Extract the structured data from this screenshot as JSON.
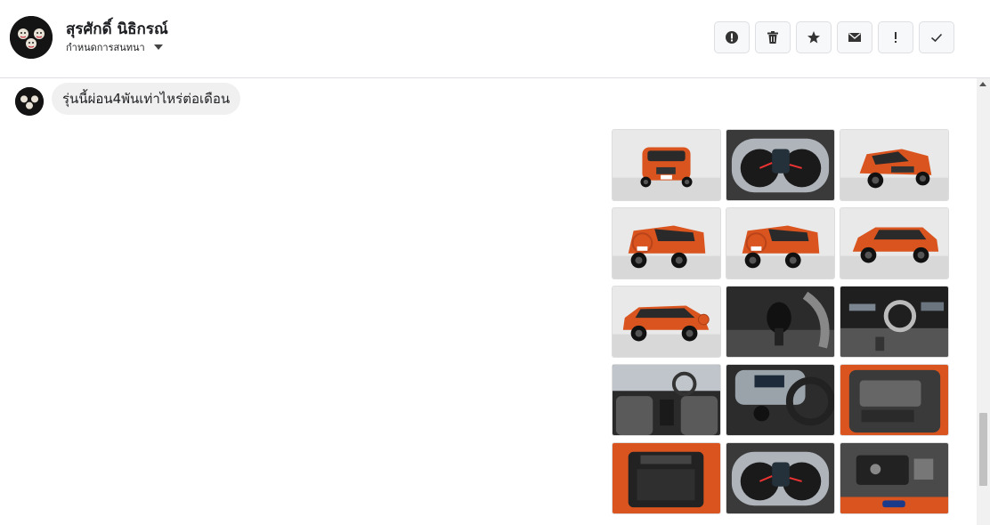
{
  "header": {
    "contact_name": "สุรศักดิ์ นิธิกรณ์",
    "subtitle": "กำหนดการสนทนา",
    "actions": [
      {
        "name": "spam-button",
        "icon": "alert-circle-icon"
      },
      {
        "name": "delete-button",
        "icon": "trash-icon"
      },
      {
        "name": "star-button",
        "icon": "star-icon"
      },
      {
        "name": "mark-unread-button",
        "icon": "envelope-icon"
      },
      {
        "name": "important-button",
        "icon": "exclamation-icon"
      },
      {
        "name": "done-button",
        "icon": "check-icon"
      }
    ]
  },
  "messages": [
    {
      "text": "รุ่นนี้ผ่อน4พันเท่าไหร่ต่อเดือน"
    }
  ],
  "attachments": [
    {
      "kind": "car-front",
      "label": "photo-1"
    },
    {
      "kind": "dashboard",
      "label": "photo-2"
    },
    {
      "kind": "car-front-angle",
      "label": "photo-3"
    },
    {
      "kind": "car-rear-angle",
      "label": "photo-4"
    },
    {
      "kind": "car-rear-angle",
      "label": "photo-5"
    },
    {
      "kind": "car-side",
      "label": "photo-6"
    },
    {
      "kind": "car-side-left",
      "label": "photo-7"
    },
    {
      "kind": "gear-shift",
      "label": "photo-8"
    },
    {
      "kind": "interior",
      "label": "photo-9"
    },
    {
      "kind": "interior-front",
      "label": "photo-10"
    },
    {
      "kind": "console",
      "label": "photo-11"
    },
    {
      "kind": "door-panel",
      "label": "photo-12"
    },
    {
      "kind": "trunk",
      "label": "photo-13"
    },
    {
      "kind": "dashboard",
      "label": "photo-14"
    },
    {
      "kind": "engine",
      "label": "photo-15"
    }
  ],
  "colors": {
    "car": "#d9541e",
    "bubble": "#f1f0f0",
    "border": "#dddfe2"
  }
}
